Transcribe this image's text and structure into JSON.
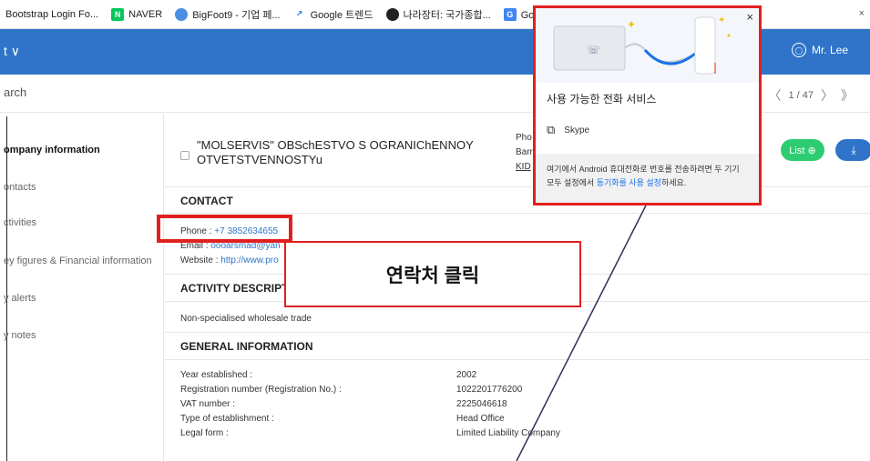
{
  "bookmarks": {
    "items": [
      {
        "label": "Bootstrap Login Fo...",
        "icon": "page-icon"
      },
      {
        "label": "NAVER",
        "icon": "naver-icon",
        "color": "#03c75a"
      },
      {
        "label": "BigFoot9 - 기업 페...",
        "icon": "bigfoot-icon"
      },
      {
        "label": "Google 트렌드",
        "icon": "trends-icon"
      },
      {
        "label": "나라장터: 국가종합...",
        "icon": "nara-icon"
      },
      {
        "label": "Google 번역",
        "icon": "translate-icon"
      }
    ],
    "close": "×"
  },
  "header": {
    "left_label": "t ∨",
    "user_name": "Mr. Lee",
    "color": "#2f74c8"
  },
  "search": {
    "placeholder": "arch"
  },
  "pager": {
    "text": "1 / 47"
  },
  "sidebar": {
    "items": [
      {
        "label": "ompany information",
        "active": true
      },
      {
        "label": "ontacts",
        "active": false
      },
      {
        "label": "ctivities",
        "active": false
      },
      {
        "label": "ey figures & Financial information",
        "active": false
      },
      {
        "label": "y alerts",
        "active": false
      },
      {
        "label": "y notes",
        "active": false
      }
    ]
  },
  "company": {
    "name": "\"MOLSERVIS\" OBSchESTVO S OGRANIChENNOY OTVETSTVENNOSTYu",
    "info_lines": [
      "Pho",
      "Barr",
      "KID"
    ],
    "list_label": "List ⊕",
    "download_icon": "download-icon"
  },
  "contact": {
    "title": "CONTACT",
    "phone_label": "Phone : ",
    "phone_value": "+7 3852634655",
    "email_label": "Email : ",
    "email_value": "oooarsmad@yan",
    "website_label": "Website : ",
    "website_value": "http://www.pro"
  },
  "activity": {
    "title": "ACTIVITY DESCRIPTIO",
    "text": "Non-specialised wholesale trade"
  },
  "general": {
    "title": "GENERAL INFORMATION",
    "rows": [
      {
        "label": "Year established :",
        "value": "2002"
      },
      {
        "label": "Registration number (Registration No.) :",
        "value": "1022201776200"
      },
      {
        "label": "VAT number :",
        "value": "2225046618"
      },
      {
        "label": "Type of establishment :",
        "value": "Head Office"
      },
      {
        "label": "Legal form :",
        "value": "Limited Liability Company"
      }
    ]
  },
  "annotation": {
    "callout_text": "연락처 클릭",
    "color": "#e02020"
  },
  "popup": {
    "title": "사용 가능한 전화 서비스",
    "close": "×",
    "service": "Skype",
    "footer_prefix": "여기에서 Android 휴대전화로 번호를 전송하려면 두 기기 모두 설정에서 ",
    "footer_link": "동기화를 사용 설정",
    "footer_suffix": "하세요."
  }
}
